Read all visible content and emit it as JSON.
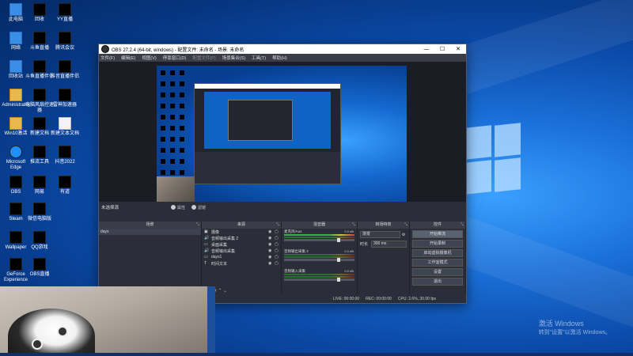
{
  "desktop": {
    "icons": [
      {
        "label": "此电脑"
      },
      {
        "label": "回收"
      },
      {
        "label": "YY直播"
      },
      {
        "label": "网络"
      },
      {
        "label": "斗鱼直播"
      },
      {
        "label": "腾讯会议"
      },
      {
        "label": "回收站"
      },
      {
        "label": "斗鱼直播伴侣"
      },
      {
        "label": "抖音直播伴侣"
      },
      {
        "label": "Administrator"
      },
      {
        "label": "电脑风扇控速器"
      },
      {
        "label": "雷神加速器"
      },
      {
        "label": "Win10激活"
      },
      {
        "label": "新建文档"
      },
      {
        "label": "新建文本文档"
      },
      {
        "label": "Microsoft Edge"
      },
      {
        "label": "推流工具"
      },
      {
        "label": "抖音2022"
      },
      {
        "label": "OBS"
      },
      {
        "label": "网易"
      },
      {
        "label": "有道"
      },
      {
        "label": "Steam"
      },
      {
        "label": "微信电脑版"
      },
      {
        "label": "Wallpaper"
      },
      {
        "label": "QQ游戏"
      },
      {
        "label": "GeForce Experience"
      },
      {
        "label": "OBS直播"
      }
    ],
    "activation": {
      "line1": "激活 Windows",
      "line2": "转到\"设置\"以激活 Windows。"
    }
  },
  "obs": {
    "title": "OBS 27.2.4 (64-bit, windows) - 配置文件: 未命名 - 场景: 未命名",
    "menu": [
      {
        "label": "文件(F)",
        "disabled": false
      },
      {
        "label": "编辑(E)",
        "disabled": false
      },
      {
        "label": "视图(V)",
        "disabled": false
      },
      {
        "label": "停靠窗口(D)",
        "disabled": false
      },
      {
        "label": "配置文件(P)",
        "disabled": true
      },
      {
        "label": "场景集合(S)",
        "disabled": false
      },
      {
        "label": "工具(T)",
        "disabled": false
      },
      {
        "label": "帮助(H)",
        "disabled": false
      }
    ],
    "status_source": "未选择源",
    "btn_props": "属性",
    "btn_filters": "滤镜",
    "docks": {
      "scenes": {
        "title": "场景",
        "items": [
          "days"
        ]
      },
      "sources": {
        "title": "来源",
        "items": [
          {
            "icon": "camera-icon",
            "glyph": "▣",
            "label": "摄像"
          },
          {
            "icon": "speaker-icon",
            "glyph": "🔊",
            "label": "音频输出采集 2"
          },
          {
            "icon": "display-icon",
            "glyph": "▭",
            "label": "桌面采集"
          },
          {
            "icon": "speaker-icon",
            "glyph": "🔊",
            "label": "音频输出采集"
          },
          {
            "icon": "display-icon",
            "glyph": "▭",
            "label": "days1"
          },
          {
            "icon": "text-icon",
            "glyph": "T",
            "label": "时间文本"
          }
        ]
      },
      "mixer": {
        "title": "混音器",
        "tracks": [
          {
            "name": "麦克风/Aux",
            "db": "0.0 dB"
          },
          {
            "name": "音频输出采集 2",
            "db": "0.0 dB"
          },
          {
            "name": "音频输入采集",
            "db": "0.0 dB"
          }
        ]
      },
      "transitions": {
        "title": "转场特效",
        "selected": "渐变",
        "duration_label": "时长",
        "duration": "300 ms"
      },
      "controls": {
        "title": "控件",
        "buttons": [
          {
            "label": "开始推流",
            "active": true
          },
          {
            "label": "开始录制",
            "active": false
          },
          {
            "label": "启动虚拟摄像机",
            "active": false
          },
          {
            "label": "工作室模式",
            "active": false
          },
          {
            "label": "设置",
            "active": false
          },
          {
            "label": "退出",
            "active": false
          }
        ]
      }
    },
    "statusbar": {
      "live": "LIVE: 00:00:00",
      "rec": "REC: 00:00:00",
      "cpu": "CPU: 2.6%, 30.00 fps"
    }
  }
}
